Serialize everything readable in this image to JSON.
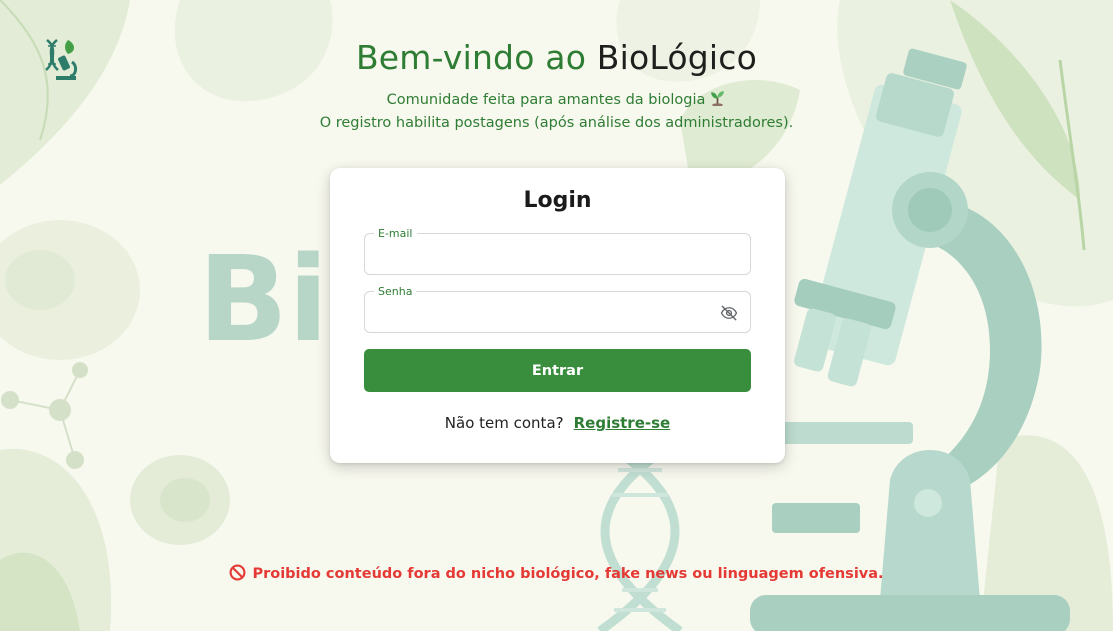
{
  "header": {
    "title_prefix": "Bem-vindo ao ",
    "title_brand": "BioLógico",
    "subtitle_line1": "Comunidade feita para amantes da biologia",
    "subtitle_line2": "O registro habilita postagens (após análise dos administradores).",
    "subtitle_icon": "sprout-icon"
  },
  "background": {
    "watermark_text": "Bio"
  },
  "login": {
    "title": "Login",
    "email_label": "E-mail",
    "email_value": "",
    "password_label": "Senha",
    "password_value": "",
    "password_toggle_icon": "eye-off-icon",
    "submit_label": "Entrar",
    "signup_prompt": "Não tem conta?",
    "signup_link": "Registre-se"
  },
  "footer": {
    "warning": "Proibido conteúdo fora do nicho biológico, fake news ou linguagem ofensiva.",
    "warning_icon": "prohibited-icon"
  },
  "colors": {
    "primary_green": "#388e3c",
    "text_green": "#2f7d34",
    "warning_red": "#e53935",
    "background": "#f7f8ee"
  }
}
